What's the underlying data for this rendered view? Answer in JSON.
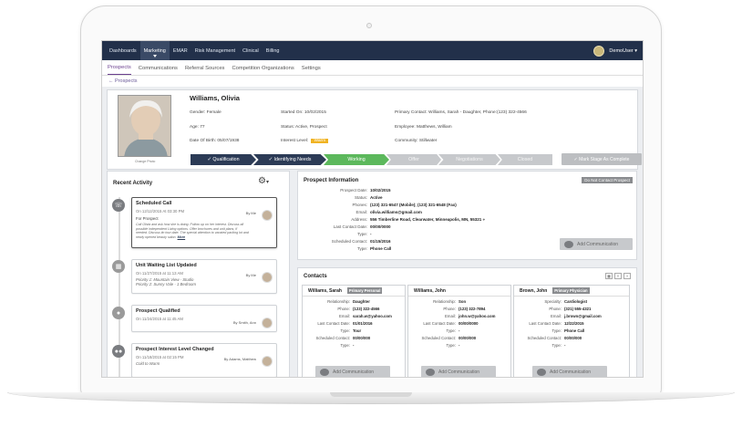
{
  "topnav": {
    "items": [
      {
        "label": "Dashboards",
        "active": false
      },
      {
        "label": "Marketing",
        "active": true
      },
      {
        "label": "EMAR",
        "active": false
      },
      {
        "label": "Risk Management",
        "active": false
      },
      {
        "label": "Clinical",
        "active": false
      },
      {
        "label": "Billing",
        "active": false
      }
    ],
    "user": "DemoUser ▾"
  },
  "subnav": {
    "items": [
      {
        "label": "Prospects",
        "active": true
      },
      {
        "label": "Communications",
        "active": false
      },
      {
        "label": "Referral Sources",
        "active": false
      },
      {
        "label": "Competition Organizations",
        "active": false
      },
      {
        "label": "Settings",
        "active": false
      }
    ]
  },
  "breadcrumb": "← Prospects",
  "prospect": {
    "name": "Williams, Olivia",
    "change_photo": "Change Photo",
    "gender": "Gender: Female",
    "age": "Age: 77",
    "dob": "Date Of Birth: 05/07/1938",
    "started": "Started On: 10/02/2015",
    "status": "Status: Active, Prospect",
    "interest_label": "Interest Level:",
    "interest_value": "Warm",
    "primary_contact": "Primary Contact: Williams, Sarah - Daughter, Phone:(123) 322-4566",
    "employee": "Employee: Matthews, William",
    "community": "Community: Stillwater"
  },
  "stages": [
    {
      "label": "✓  Qualification",
      "state": "done"
    },
    {
      "label": "✓ Identifying Needs",
      "state": "done"
    },
    {
      "label": "Working",
      "state": "cur"
    },
    {
      "label": "Offer",
      "state": "todo"
    },
    {
      "label": "Negotiations",
      "state": "todo"
    },
    {
      "label": "Closed",
      "state": "todo"
    }
  ],
  "mark_stage_button": "✓  Mark Stage As Complete",
  "recent_activity": {
    "title": "Recent Activity",
    "items": [
      {
        "title": "Scheduled Call",
        "line1": "On 12/12/2015 At 03:30 PM",
        "by": "By Me",
        "line2": "For Prospect",
        "body": "Call Olivia and ask how she is doing. Follow up on her interest. Discuss all possible independent Living options. Offer brochures and unit plans, if needed. Discuss tin tour date. The special attention to vacated parking lot and newly opened beauty salon.",
        "more": "More"
      },
      {
        "title": "Unit Waiting List Updated",
        "line1": "On 11/27/2015 at 11:13 AM",
        "by": "By Me",
        "line2": "Priority 1: Mountain View - Studio",
        "line3": "Priority 2: Sunny Vale - 1 Bedroom"
      },
      {
        "title": "Prospect Qualified",
        "line1": "On 11/24/2015 at 11:45 AM",
        "by": "By Smith, Ann"
      },
      {
        "title": "Prospect Interest Level Changed",
        "line1": "On 11/18/2015 at 02:15 PM",
        "by": "By Adams, Matthew",
        "line2": "Cold to Warm"
      }
    ]
  },
  "prospect_info": {
    "title": "Prospect Information",
    "dnc": "Do Not Contact Prospect",
    "fields": [
      {
        "label": "Prospect Date:",
        "value": "10/02/2015"
      },
      {
        "label": "Status:",
        "value": "Active"
      },
      {
        "label": "Phones:",
        "value": "(123) 321-6547 (Mobile); (123) 321-6548 (Fax)"
      },
      {
        "label": "Email:",
        "value": "olivia.williams@gmail.com"
      },
      {
        "label": "Address:",
        "value": "556 Timberline Road, Clearwater, Minneapolis, MN, 55321"
      },
      {
        "label": "Last Contact Date:",
        "value": "00/00/0000"
      },
      {
        "label": "Type:",
        "value": "-"
      },
      {
        "label": "Scheduled Contact:",
        "value": "01/15/2016"
      },
      {
        "label": "Type:",
        "value": "Phone Call"
      }
    ],
    "add_comm": "Add Communication"
  },
  "contacts": {
    "title": "Contacts",
    "cards": [
      {
        "name": "Williams, Sarah",
        "badge": "Primary Personal",
        "rows": [
          {
            "l": "Relationship:",
            "v": "Daughter"
          },
          {
            "l": "Phone:",
            "v": "(123) 322-4566"
          },
          {
            "l": "Email:",
            "v": "sarah.w@yahoo.com"
          },
          {
            "l": "Last Contact Date:",
            "v": "01/01/2016"
          },
          {
            "l": "Type:",
            "v": "Tour"
          },
          {
            "l": "Scheduled Contact:",
            "v": "00/00/000"
          },
          {
            "l": "Type:",
            "v": "-"
          }
        ],
        "add_comm": "Add Communication"
      },
      {
        "name": "Williams, John",
        "badge": "",
        "rows": [
          {
            "l": "Relationship:",
            "v": "Son"
          },
          {
            "l": "Phone:",
            "v": "(123) 322-7894"
          },
          {
            "l": "Email:",
            "v": "john.w@yahoo.com"
          },
          {
            "l": "Last Contact Date:",
            "v": "00/00/0000"
          },
          {
            "l": "Type:",
            "v": "-"
          },
          {
            "l": "Scheduled Contact:",
            "v": "00/00/000"
          },
          {
            "l": "Type:",
            "v": "-"
          }
        ],
        "add_comm": "Add Communication"
      },
      {
        "name": "Brown, John",
        "badge": "Primary Physician",
        "rows": [
          {
            "l": "Specialty:",
            "v": "Cardiologist"
          },
          {
            "l": "Phone:",
            "v": "(321) 555-4321"
          },
          {
            "l": "Email:",
            "v": "j.brown@gmail.com"
          },
          {
            "l": "Last Contact Date:",
            "v": "12/22/2015"
          },
          {
            "l": "Type:",
            "v": "Phone Call"
          },
          {
            "l": "Scheduled Contact:",
            "v": "00/00/000"
          },
          {
            "l": "Type:",
            "v": "-"
          }
        ],
        "add_comm": "Add Communication"
      }
    ]
  },
  "colors": {
    "nav": "#22304a",
    "accent": "#6a3f8f",
    "stage_done": "#2c3b56",
    "stage_current": "#5cb85c",
    "warm": "#f0b323"
  }
}
